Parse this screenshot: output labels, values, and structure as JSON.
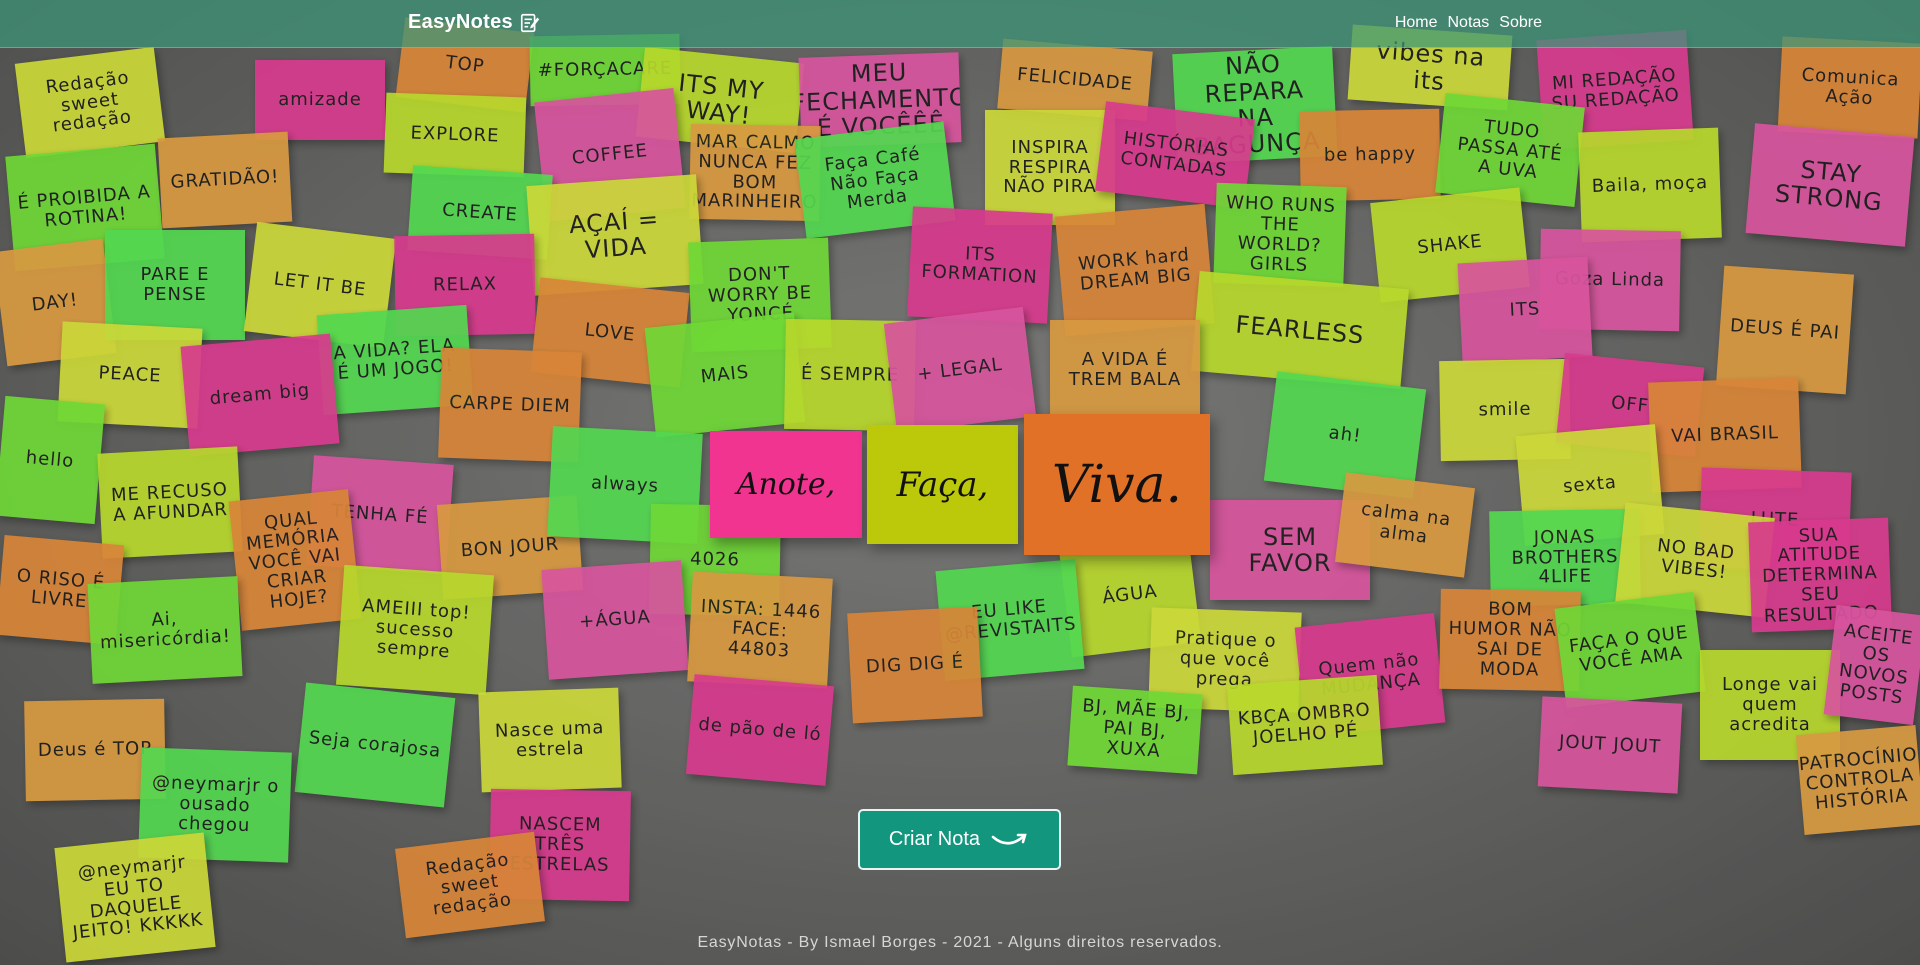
{
  "navbar": {
    "brand": "EasyNotes",
    "brand_icon": "notepad-pencil-icon",
    "links": [
      "Home",
      "Notas",
      "Sobre"
    ]
  },
  "hero": {
    "notes": [
      {
        "text": "Anote,",
        "color": "#f13490"
      },
      {
        "text": "Faça,",
        "color": "#bcc90b"
      },
      {
        "text": "Viva.",
        "color": "#e07127"
      }
    ]
  },
  "cta": {
    "label": "Criar Nota",
    "icon": "smile-arrow-icon",
    "color": "#13967e"
  },
  "footer": {
    "text": "EasyNotas - By Ismael Borges - 2021 - Alguns direitos reservados."
  },
  "background_notes": [
    "Redação sweet redação",
    "amizade",
    "TOP",
    "#FORÇACARE",
    "ITS MY WAY!",
    "MEU FECHAMENTO É VOCÊÊÊ",
    "FELICIDADE",
    "NÃO REPARA NA BAGUNÇA",
    "vibes na its",
    "MI REDAÇÃO SU REDAÇÃO",
    "Comunica Ação",
    "É PROIBIDA A ROTINA!",
    "EXPLORE",
    "COFFEE",
    "MAR CALMO NUNCA FEZ BOM MARINHEIRO",
    "Faça Café Não Faça Merda",
    "INSPIRA RESPIRA NÃO PIRA",
    "HISTÓRIAS CONTADAS",
    "be happy",
    "TUDO PASSA ATÉ A UVA",
    "Baila, moça",
    "STAY STRONG",
    "GRATIDÃO!",
    "CREATE",
    "AÇAÍ = VIDA",
    "ITS FORMATION",
    "WORK hard DREAM BIG",
    "WHO RUNS THE WORLD? GIRLS",
    "SHAKE",
    "Goza Linda",
    "DAY!",
    "PARE E PENSE",
    "LET IT BE",
    "RELAX",
    "LOVE",
    "DON'T WORRY BE YONCÉ",
    "FEARLESS",
    "ITS",
    "DEUS É PAI",
    "A VIDA? ELA É UM JOGO!",
    "PEACE",
    "dream big",
    "CARPE DIEM",
    "MAIS",
    "É SEMPRE",
    "+ LEGAL",
    "A VIDA É TREM BALA",
    "ah!",
    "smile",
    "OFF",
    "VAI BRASIL",
    "hello",
    "ME RECUSO A AFUNDAR",
    "TENHA FÉ",
    "BON JOUR",
    "always",
    "sexta",
    "LUTE",
    "QUAL MEMÓRIA VOCÊ VAI CRIAR HOJE?",
    "4026",
    "ÁGUA",
    "SEM FAVOR",
    "calma na alma",
    "JONAS BROTHERS 4LIFE",
    "NO BAD VIBES!",
    "SUA ATITUDE DETERMINA SEU RESULTADO",
    "O RISO É LIVRE",
    "Ai, misericórdia!",
    "AMEIII top! sucesso sempre",
    "+ÁGUA",
    "INSTA: 1446 FACE: 44803",
    "EU LIKE @REVISTAITS",
    "Pratique o que você prega",
    "Quem não MUDANÇA",
    "BOM HUMOR NÃO SAI DE MODA",
    "FAÇA O QUE VOCÊ AMA",
    "Longe vai quem acredita",
    "ACEITE OS NOVOS POSTS",
    "Deus é TOP",
    "Seja corajosa",
    "Nasce uma estrela",
    "de pão de ló",
    "DIG DIG É",
    "BJ, MÃE BJ, PAI BJ, XUXA",
    "KBÇA OMBRO JOELHO PÉ",
    "JOUT JOUT",
    "PATROCÍNIO CONTROLA HISTÓRIA",
    "@neymarjr o ousado chegou",
    "@neymarjr EU TO DAQUELE JEITO! KKKKK",
    "NASCEM TRÊS ESTRELAS"
  ]
}
